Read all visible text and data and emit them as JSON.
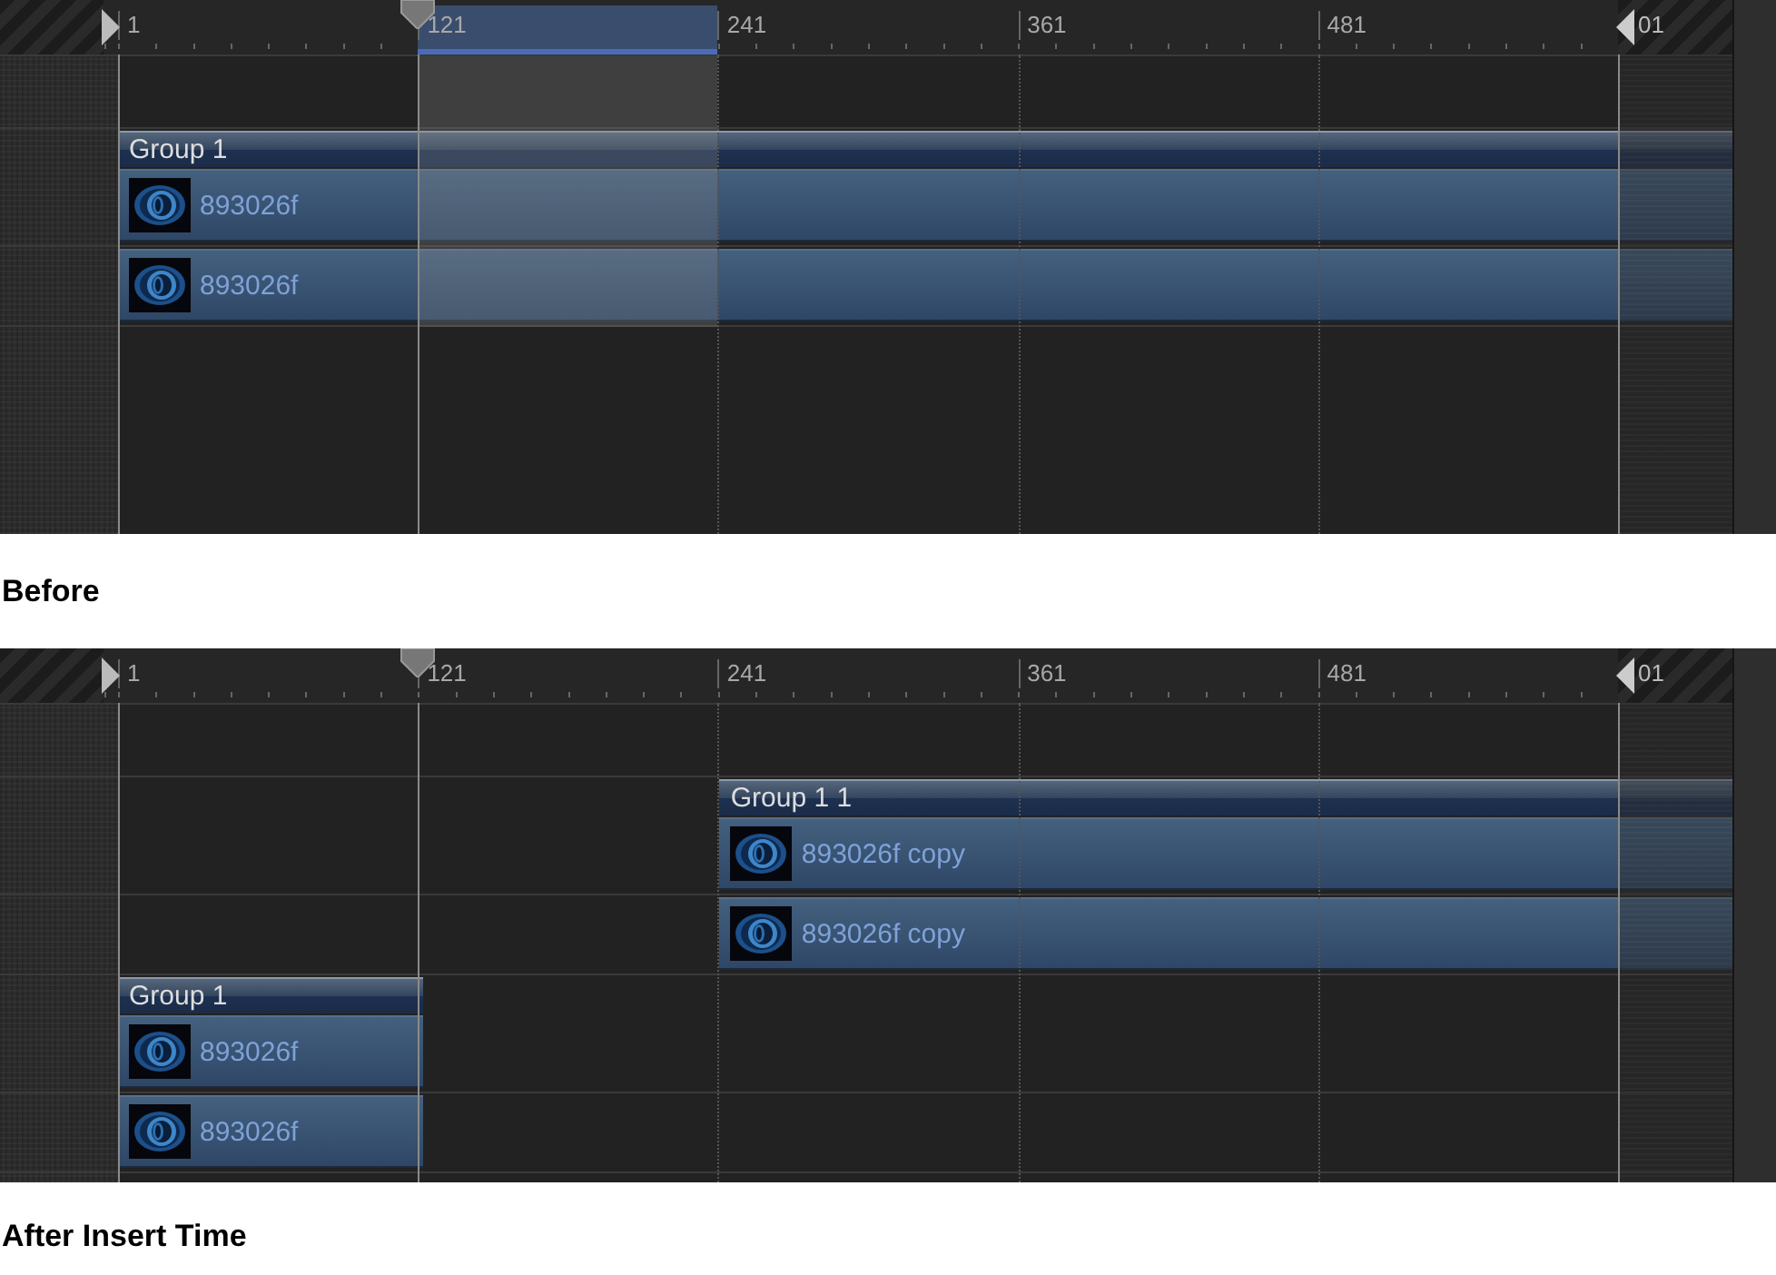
{
  "panels": [
    {
      "ruler": {
        "ticks": [
          "1",
          "121",
          "241",
          "361",
          "481",
          "01"
        ]
      },
      "selection_shown": true,
      "groups": [
        {
          "name": "Group 1",
          "kind": "full",
          "layers": [
            {
              "name": "893026f"
            },
            {
              "name": "893026f"
            }
          ]
        }
      ],
      "caption": "Before"
    },
    {
      "ruler": {
        "ticks": [
          "1",
          "121",
          "241",
          "361",
          "481",
          "01"
        ]
      },
      "selection_shown": false,
      "groups": [
        {
          "name": "Group 1 1",
          "kind": "tail",
          "layers": [
            {
              "name": "893026f copy"
            },
            {
              "name": "893026f copy"
            }
          ]
        },
        {
          "name": "Group 1",
          "kind": "head",
          "layers": [
            {
              "name": "893026f"
            },
            {
              "name": "893026f"
            }
          ]
        }
      ],
      "caption": "After Insert Time"
    }
  ]
}
